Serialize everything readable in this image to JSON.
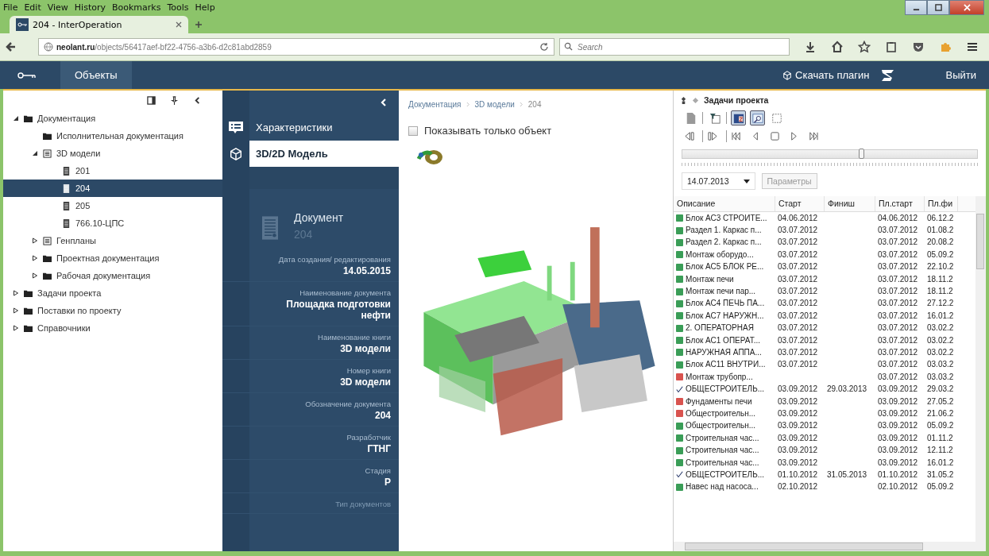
{
  "browser": {
    "menu": [
      "File",
      "Edit",
      "View",
      "History",
      "Bookmarks",
      "Tools",
      "Help"
    ],
    "tabs": [
      {
        "title": "204 - InterOperation",
        "selected": true
      }
    ],
    "url": {
      "domain": "neolant.ru",
      "path": "/objects/56417aef-bf22-4756-a3b6-d2c81abd2859"
    },
    "search": {
      "placeholder": "Search"
    }
  },
  "header": {
    "nav": [
      {
        "label": "Объекты",
        "selected": true
      }
    ],
    "download": "Скачать плагин",
    "logout": "Выйти"
  },
  "tree": [
    {
      "label": "Документация",
      "kind": "folder",
      "selected": false,
      "expanded": true,
      "children": [
        {
          "label": "Исполнительная документация",
          "kind": "folder",
          "selected": false
        },
        {
          "label": "3D модели",
          "kind": "section",
          "selected": false,
          "expanded": true,
          "children": [
            {
              "label": "201",
              "kind": "document",
              "selected": false
            },
            {
              "label": "204",
              "kind": "document",
              "selected": true
            },
            {
              "label": "205",
              "kind": "document",
              "selected": false
            },
            {
              "label": "766.10-ЦПС",
              "kind": "document",
              "selected": false
            }
          ]
        },
        {
          "label": "Генпланы",
          "kind": "section",
          "selected": false,
          "expanded": false
        },
        {
          "label": "Проектная документация",
          "kind": "folder",
          "selected": false,
          "expanded": false
        },
        {
          "label": "Рабочая документация",
          "kind": "folder",
          "selected": false,
          "expanded": false
        }
      ]
    },
    {
      "label": "Задачи проекта",
      "kind": "folder",
      "selected": false,
      "expanded": false
    },
    {
      "label": "Поставки по проекту",
      "kind": "folder",
      "selected": false,
      "expanded": false
    },
    {
      "label": "Справочники",
      "kind": "folder",
      "selected": false,
      "expanded": false
    }
  ],
  "object_nav": [
    {
      "label": "Характеристики",
      "kind": "list",
      "selected": false
    },
    {
      "label": "3D/2D Модель",
      "kind": "cube",
      "selected": true
    }
  ],
  "document": {
    "title": "Документ",
    "number": "204"
  },
  "properties": [
    {
      "label": "Дата создания/ редактирования",
      "value": "14.05.2015",
      "faded": false
    },
    {
      "label": "Наименование документа",
      "value": "Площадка подготовки нефти",
      "faded": false
    },
    {
      "label": "Наименование книги",
      "value": "3D модели",
      "faded": false
    },
    {
      "label": "Номер книги",
      "value": "3D модели",
      "faded": false
    },
    {
      "label": "Обозначение документа",
      "value": "204",
      "faded": false
    },
    {
      "label": "Разработчик",
      "value": "ГТНГ",
      "faded": false
    },
    {
      "label": "Стадия",
      "value": "Р",
      "faded": false
    },
    {
      "label": "Тип документов",
      "faded": true
    }
  ],
  "breadcrumb": [
    "Документация",
    "3D модели",
    "204"
  ],
  "only_object": {
    "label": "Показывать только объект",
    "checked": false
  },
  "model": {
    "kind": "picture"
  },
  "tasks": {
    "title": "Задачи проекта",
    "toolbar": [
      {
        "kind": "page",
        "on": false
      },
      {
        "kind": "filter",
        "on": false
      },
      {
        "kind": "calendar",
        "on": true
      },
      {
        "kind": "zoom",
        "on": true
      },
      {
        "kind": "select",
        "on": false
      }
    ],
    "timeline": {
      "level": 0.61
    },
    "date": "14.07.2013",
    "params": "Параметры",
    "columns": [
      "Описание",
      "Старт",
      "Финиш",
      "Пл.старт",
      "Пл.фи"
    ],
    "rows": [
      {
        "kind": "green",
        "name": "Блок АС3 СТРОИТЕ...",
        "start": "04.06.2012",
        "plan_start": "04.06.2012",
        "plan_finish": "06.12.2"
      },
      {
        "kind": "green",
        "name": "Раздел 1. Каркас п...",
        "start": "03.07.2012",
        "plan_start": "03.07.2012",
        "plan_finish": "01.08.2"
      },
      {
        "kind": "green",
        "name": "Раздел 2. Каркас п...",
        "start": "03.07.2012",
        "plan_start": "03.07.2012",
        "plan_finish": "20.08.2"
      },
      {
        "kind": "green",
        "name": "Монтаж оборудо...",
        "start": "03.07.2012",
        "plan_start": "03.07.2012",
        "plan_finish": "05.09.2"
      },
      {
        "kind": "green",
        "name": "Блок АС5 БЛОК РЕ...",
        "start": "03.07.2012",
        "plan_start": "03.07.2012",
        "plan_finish": "22.10.2"
      },
      {
        "kind": "green",
        "name": "Монтаж печи",
        "start": "03.07.2012",
        "plan_start": "03.07.2012",
        "plan_finish": "18.11.2"
      },
      {
        "kind": "green",
        "name": "Монтаж печи пар...",
        "start": "03.07.2012",
        "plan_start": "03.07.2012",
        "plan_finish": "18.11.2"
      },
      {
        "kind": "green",
        "name": "Блок АС4 ПЕЧЬ ПА...",
        "start": "03.07.2012",
        "plan_start": "03.07.2012",
        "plan_finish": "27.12.2"
      },
      {
        "kind": "green",
        "name": "Блок АС7 НАРУЖН...",
        "start": "03.07.2012",
        "plan_start": "03.07.2012",
        "plan_finish": "16.01.2"
      },
      {
        "kind": "green",
        "name": "2. ОПЕРАТОРНАЯ",
        "start": "03.07.2012",
        "plan_start": "03.07.2012",
        "plan_finish": "03.02.2"
      },
      {
        "kind": "green",
        "name": "Блок АС1 ОПЕРАТ...",
        "start": "03.07.2012",
        "plan_start": "03.07.2012",
        "plan_finish": "03.02.2"
      },
      {
        "kind": "green",
        "name": "НАРУЖНАЯ АППА...",
        "start": "03.07.2012",
        "plan_start": "03.07.2012",
        "plan_finish": "03.02.2"
      },
      {
        "kind": "green",
        "name": "Блок АС11 ВНУТРИ...",
        "start": "03.07.2012",
        "plan_start": "03.07.2012",
        "plan_finish": "03.03.2"
      },
      {
        "kind": "red",
        "name": "Монтаж трубопр...",
        "plan_start": "03.07.2012",
        "plan_finish": "03.03.2"
      },
      {
        "kind": "done",
        "name": "ОБЩЕСТРОИТЕЛЬ...",
        "start": "03.09.2012",
        "finish": "29.03.2013",
        "plan_start": "03.09.2012",
        "plan_finish": "29.03.2"
      },
      {
        "kind": "red",
        "name": "Фундаменты печи",
        "start": "03.09.2012",
        "plan_start": "03.09.2012",
        "plan_finish": "27.05.2"
      },
      {
        "kind": "red",
        "name": "Общестроительн...",
        "start": "03.09.2012",
        "plan_start": "03.09.2012",
        "plan_finish": "21.06.2"
      },
      {
        "kind": "green",
        "name": "Общестроительн...",
        "start": "03.09.2012",
        "plan_start": "03.09.2012",
        "plan_finish": "05.09.2"
      },
      {
        "kind": "green",
        "name": "Строительная час...",
        "start": "03.09.2012",
        "plan_start": "03.09.2012",
        "plan_finish": "01.11.2"
      },
      {
        "kind": "green",
        "name": "Строительная час...",
        "start": "03.09.2012",
        "plan_start": "03.09.2012",
        "plan_finish": "12.11.2"
      },
      {
        "kind": "green",
        "name": "Строительная час...",
        "start": "03.09.2012",
        "plan_start": "03.09.2012",
        "plan_finish": "16.01.2"
      },
      {
        "kind": "done",
        "name": "ОБЩЕСТРОИТЕЛЬ...",
        "start": "01.10.2012",
        "finish": "31.05.2013",
        "plan_start": "01.10.2012",
        "plan_finish": "31.05.2"
      },
      {
        "kind": "green",
        "name": "Навес над насоса...",
        "start": "02.10.2012",
        "plan_start": "02.10.2012",
        "plan_finish": "05.09.2"
      }
    ]
  }
}
